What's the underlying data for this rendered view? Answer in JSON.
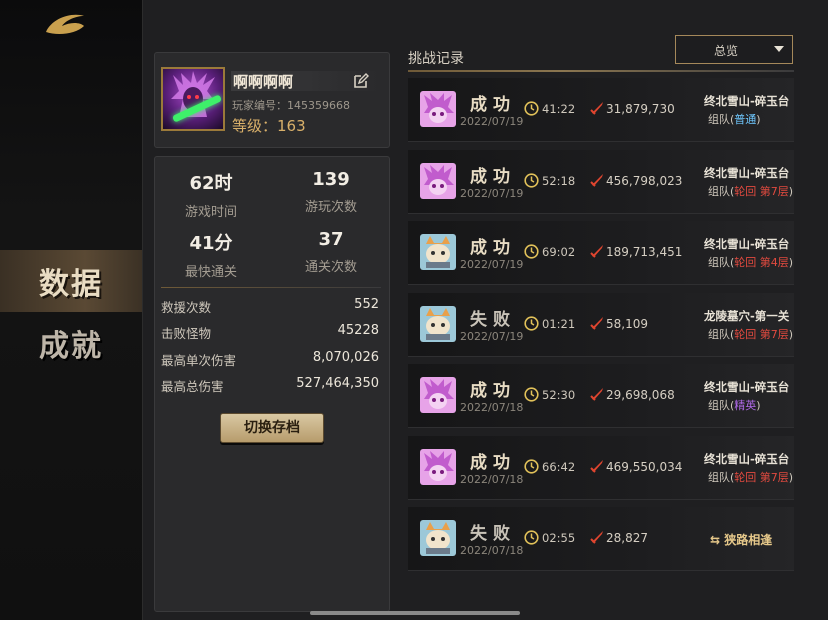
{
  "sidebar": {
    "items": [
      {
        "label": "数据",
        "active": true
      },
      {
        "label": "成就",
        "active": false
      }
    ]
  },
  "profile": {
    "name": "啊啊啊啊",
    "id_text": "玩家编号：145359668",
    "level_text": "等级：163"
  },
  "stats": {
    "play_time": {
      "value": "62时",
      "label": "游戏时间"
    },
    "play_count": {
      "value": "139",
      "label": "游玩次数"
    },
    "fastest_clear": {
      "value": "41分",
      "label": "最快通关"
    },
    "clear_count": {
      "value": "37",
      "label": "通关次数"
    },
    "rows": [
      {
        "label": "救援次数",
        "value": "552"
      },
      {
        "label": "击败怪物",
        "value": "45228"
      },
      {
        "label": "最高单次伤害",
        "value": "8,070,026"
      },
      {
        "label": "最高总伤害",
        "value": "527,464,350"
      }
    ],
    "switch_button": "切换存档"
  },
  "records_header": {
    "title": "挑战记录",
    "filter_selected": "总览"
  },
  "colors": {
    "success": "#e8dcc4",
    "fail": "#c9c3b8",
    "normal_mode": "#6fc8ff",
    "reincarnation_mode": "#e24a3f",
    "elite_mode": "#b06ae8",
    "accent_gold": "#a5885a"
  },
  "records": [
    {
      "result": "成功",
      "success": true,
      "date": "2022/07/19",
      "time": "41:22",
      "damage": "31,879,730",
      "stage": "终北雪山-碎玉台",
      "mode_prefix": "组队(",
      "mode_tag": "普通",
      "mode_class": "p",
      "mode_suffix": ")",
      "portrait": "purple"
    },
    {
      "result": "成功",
      "success": true,
      "date": "2022/07/19",
      "time": "52:18",
      "damage": "456,798,023",
      "stage": "终北雪山-碎玉台",
      "mode_prefix": "组队(",
      "mode_tag": "轮回 第7层",
      "mode_class": "r",
      "mode_suffix": ")",
      "portrait": "purple"
    },
    {
      "result": "成功",
      "success": true,
      "date": "2022/07/19",
      "time": "69:02",
      "damage": "189,713,451",
      "stage": "终北雪山-碎玉台",
      "mode_prefix": "组队(",
      "mode_tag": "轮回 第4层",
      "mode_class": "r",
      "mode_suffix": ")",
      "portrait": "cat"
    },
    {
      "result": "失败",
      "success": false,
      "date": "2022/07/19",
      "time": "01:21",
      "damage": "58,109",
      "stage": "龙陵墓穴-第一关",
      "mode_prefix": "组队(",
      "mode_tag": "轮回 第7层",
      "mode_class": "r",
      "mode_suffix": ")",
      "portrait": "cat"
    },
    {
      "result": "成功",
      "success": true,
      "date": "2022/07/18",
      "time": "52:30",
      "damage": "29,698,068",
      "stage": "终北雪山-碎玉台",
      "mode_prefix": "组队(",
      "mode_tag": "精英",
      "mode_class": "e",
      "mode_suffix": ")",
      "portrait": "purple"
    },
    {
      "result": "成功",
      "success": true,
      "date": "2022/07/18",
      "time": "66:42",
      "damage": "469,550,034",
      "stage": "终北雪山-碎玉台",
      "mode_prefix": "组队(",
      "mode_tag": "轮回 第7层",
      "mode_class": "r",
      "mode_suffix": ")",
      "portrait": "purple"
    },
    {
      "result": "失败",
      "success": false,
      "date": "2022/07/18",
      "time": "02:55",
      "damage": "28,827",
      "special": "狭路相逢",
      "portrait": "cat"
    }
  ]
}
